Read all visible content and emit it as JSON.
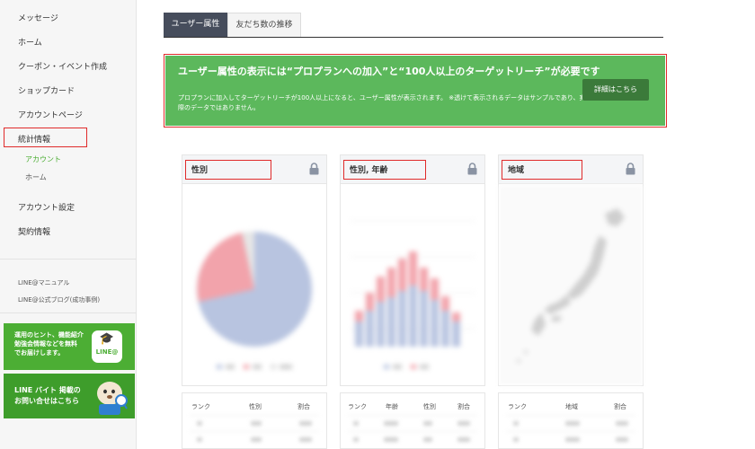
{
  "sidebar": {
    "items": [
      {
        "label": "メッセージ"
      },
      {
        "label": "ホーム"
      },
      {
        "label": "クーポン・イベント作成"
      },
      {
        "label": "ショップカード"
      },
      {
        "label": "アカウントページ"
      },
      {
        "label": "統計情報"
      },
      {
        "label": "アカウント設定"
      },
      {
        "label": "契約情報"
      }
    ],
    "sub_items": [
      {
        "label": "アカウント",
        "active": true
      },
      {
        "label": "ホーム",
        "active": false
      }
    ],
    "links": [
      {
        "label": "LINE@マニュアル"
      },
      {
        "label": "LINE@公式ブログ(成功事例)"
      }
    ],
    "banner1": {
      "lines": [
        "運用のヒント、機能紹介",
        "勉強会情報などを無料",
        "でお届けします。"
      ],
      "logo_label": "LINE@"
    },
    "banner2": {
      "lines": [
        "LINE バイト 掲載の",
        "お問い合せはこちら"
      ]
    }
  },
  "tabs": [
    {
      "label": "ユーザー属性",
      "active": true
    },
    {
      "label": "友だち数の推移",
      "active": false
    }
  ],
  "notice": {
    "title": "ユーザー属性の表示には“プロプランへの加入”と“100人以上のターゲットリーチ”が必要です",
    "body": "プロプランに加入してターゲットリーチが100人以上になると、ユーザー属性が表示されます。 ※透けて表示されるデータはサンプルであり、実際のデータではありません。",
    "button": "詳細はこちら"
  },
  "cards": [
    {
      "title": "性別",
      "lock_icon": "lock-icon"
    },
    {
      "title": "性別, 年齢",
      "lock_icon": "lock-icon"
    },
    {
      "title": "地域",
      "lock_icon": "lock-icon"
    }
  ],
  "tables": [
    {
      "headers": [
        "ランク",
        "性別",
        "割合"
      ]
    },
    {
      "headers": [
        "ランク",
        "年齢",
        "性別",
        "割合"
      ]
    },
    {
      "headers": [
        "ランク",
        "地域",
        "割合"
      ]
    }
  ],
  "colors": {
    "accent_green": "#5cb85c",
    "tab_active": "#464d5c",
    "highlight_red": "#e02b2b",
    "chart_blue": "#b8c4e0",
    "chart_red": "#f2a3ab"
  }
}
